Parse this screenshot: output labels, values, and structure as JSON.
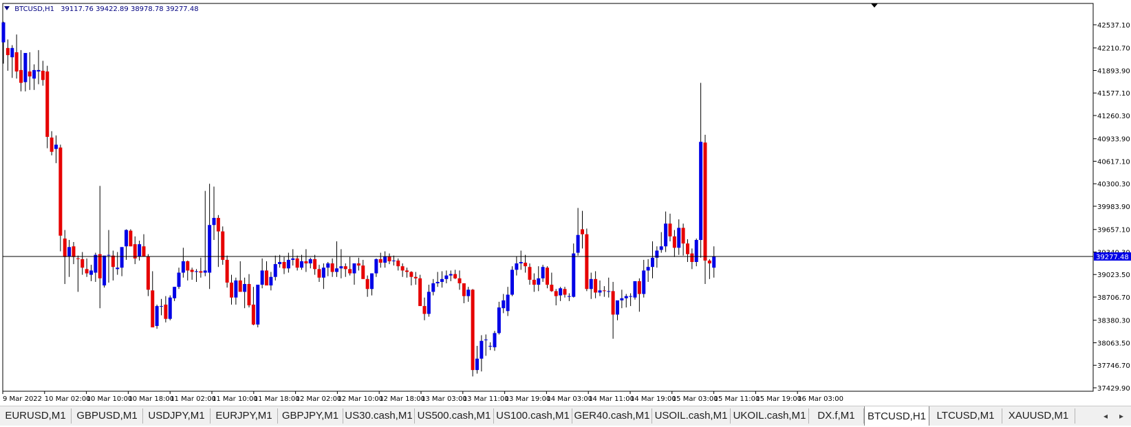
{
  "header": {
    "symbol_label": "BTCUSD,H1",
    "ohlc_label": "39117.76 39422.89 38978.78 39277.48"
  },
  "colors": {
    "bull_candle": "#0000e6",
    "bear_candle": "#e60000",
    "wick": "#000000",
    "price_line": "#000000",
    "price_label_bg": "#0000e6",
    "price_label_text": "#ffffff",
    "chart_bg": "#ffffff",
    "axis_text": "#000000"
  },
  "chart_data": {
    "type": "candlestick",
    "symbol": "BTCUSD",
    "timeframe": "H1",
    "ylim": [
      37429.9,
      42690
    ],
    "y_ticks": [
      "42537.10",
      "42210.70",
      "41893.90",
      "41577.10",
      "41260.30",
      "40933.90",
      "40617.10",
      "40300.30",
      "39983.90",
      "39657.10",
      "39340.30",
      "39023.50",
      "38706.70",
      "38380.30",
      "38063.50",
      "37746.70",
      "37429.90"
    ],
    "x_ticks": [
      "9 Mar 2022",
      "10 Mar 02:00",
      "10 Mar 10:00",
      "10 Mar 18:00",
      "11 Mar 02:00",
      "11 Mar 10:00",
      "11 Mar 18:00",
      "12 Mar 02:00",
      "12 Mar 10:00",
      "12 Mar 18:00",
      "13 Mar 03:00",
      "13 Mar 11:00",
      "13 Mar 19:00",
      "14 Mar 03:00",
      "14 Mar 11:00",
      "14 Mar 19:00",
      "15 Mar 03:00",
      "15 Mar 11:00",
      "15 Mar 19:00",
      "16 Mar 03:00"
    ],
    "current_price": "39277.48",
    "candles": [
      {
        "o": 42290,
        "h": 42580,
        "l": 41990,
        "c": 42570
      },
      {
        "o": 42210,
        "h": 42330,
        "l": 41890,
        "c": 42110
      },
      {
        "o": 42080,
        "h": 42250,
        "l": 41790,
        "c": 42210
      },
      {
        "o": 42150,
        "h": 42400,
        "l": 41780,
        "c": 41880
      },
      {
        "o": 41900,
        "h": 42180,
        "l": 41600,
        "c": 41720
      },
      {
        "o": 41730,
        "h": 42100,
        "l": 41600,
        "c": 42140
      },
      {
        "o": 41880,
        "h": 42150,
        "l": 41620,
        "c": 41810
      },
      {
        "o": 41780,
        "h": 41980,
        "l": 41620,
        "c": 41900
      },
      {
        "o": 41880,
        "h": 42180,
        "l": 41700,
        "c": 41900
      },
      {
        "o": 41890,
        "h": 42030,
        "l": 41680,
        "c": 41760
      },
      {
        "o": 41880,
        "h": 41960,
        "l": 40800,
        "c": 40960
      },
      {
        "o": 40950,
        "h": 41040,
        "l": 40700,
        "c": 40750
      },
      {
        "o": 40790,
        "h": 40980,
        "l": 40590,
        "c": 40850
      },
      {
        "o": 40810,
        "h": 40850,
        "l": 39350,
        "c": 39570
      },
      {
        "o": 39530,
        "h": 39650,
        "l": 38890,
        "c": 39270
      },
      {
        "o": 39280,
        "h": 39510,
        "l": 38990,
        "c": 39410
      },
      {
        "o": 39420,
        "h": 39480,
        "l": 39170,
        "c": 39270
      },
      {
        "o": 39250,
        "h": 39290,
        "l": 38780,
        "c": 39240
      },
      {
        "o": 39240,
        "h": 39340,
        "l": 39020,
        "c": 39120
      },
      {
        "o": 39100,
        "h": 39250,
        "l": 38990,
        "c": 39040
      },
      {
        "o": 39020,
        "h": 39160,
        "l": 38930,
        "c": 39080
      },
      {
        "o": 39050,
        "h": 39330,
        "l": 38920,
        "c": 39300
      },
      {
        "o": 39310,
        "h": 40270,
        "l": 38550,
        "c": 38970
      },
      {
        "o": 38870,
        "h": 39220,
        "l": 38840,
        "c": 39290
      },
      {
        "o": 39290,
        "h": 39650,
        "l": 38910,
        "c": 39300
      },
      {
        "o": 39290,
        "h": 39360,
        "l": 38940,
        "c": 39130
      },
      {
        "o": 39100,
        "h": 39340,
        "l": 39020,
        "c": 39120
      },
      {
        "o": 39120,
        "h": 39390,
        "l": 39000,
        "c": 39410
      },
      {
        "o": 39420,
        "h": 39660,
        "l": 39230,
        "c": 39650
      },
      {
        "o": 39640,
        "h": 39660,
        "l": 39420,
        "c": 39420
      },
      {
        "o": 39450,
        "h": 39560,
        "l": 39170,
        "c": 39250
      },
      {
        "o": 39280,
        "h": 39500,
        "l": 39220,
        "c": 39450
      },
      {
        "o": 39420,
        "h": 39590,
        "l": 39300,
        "c": 39280
      },
      {
        "o": 39280,
        "h": 39310,
        "l": 38720,
        "c": 38810
      },
      {
        "o": 38800,
        "h": 39070,
        "l": 38540,
        "c": 38280
      },
      {
        "o": 38300,
        "h": 38600,
        "l": 38260,
        "c": 38580
      },
      {
        "o": 38580,
        "h": 38680,
        "l": 38450,
        "c": 38580
      },
      {
        "o": 38600,
        "h": 38720,
        "l": 38350,
        "c": 38400
      },
      {
        "o": 38400,
        "h": 38730,
        "l": 38380,
        "c": 38700
      },
      {
        "o": 38690,
        "h": 38850,
        "l": 38650,
        "c": 38850
      },
      {
        "o": 38850,
        "h": 39120,
        "l": 38820,
        "c": 39050
      },
      {
        "o": 39050,
        "h": 39400,
        "l": 38980,
        "c": 39210
      },
      {
        "o": 39210,
        "h": 39220,
        "l": 38940,
        "c": 39080
      },
      {
        "o": 39090,
        "h": 39120,
        "l": 38950,
        "c": 39060
      },
      {
        "o": 39060,
        "h": 39100,
        "l": 38920,
        "c": 39070
      },
      {
        "o": 39070,
        "h": 39260,
        "l": 38980,
        "c": 39050
      },
      {
        "o": 39050,
        "h": 40200,
        "l": 39000,
        "c": 39080
      },
      {
        "o": 39050,
        "h": 40300,
        "l": 38820,
        "c": 39720
      },
      {
        "o": 39720,
        "h": 40260,
        "l": 39510,
        "c": 39820
      },
      {
        "o": 39820,
        "h": 39860,
        "l": 39130,
        "c": 39630
      },
      {
        "o": 39630,
        "h": 39700,
        "l": 39160,
        "c": 39230
      },
      {
        "o": 39230,
        "h": 39290,
        "l": 38840,
        "c": 38910
      },
      {
        "o": 38910,
        "h": 39020,
        "l": 38600,
        "c": 38700
      },
      {
        "o": 38700,
        "h": 38980,
        "l": 38600,
        "c": 38940
      },
      {
        "o": 38940,
        "h": 39210,
        "l": 38790,
        "c": 38780
      },
      {
        "o": 38780,
        "h": 38980,
        "l": 38550,
        "c": 38890
      },
      {
        "o": 38890,
        "h": 39030,
        "l": 38560,
        "c": 38590
      },
      {
        "o": 38600,
        "h": 38850,
        "l": 38310,
        "c": 38320
      },
      {
        "o": 38320,
        "h": 38720,
        "l": 38280,
        "c": 38880
      },
      {
        "o": 38880,
        "h": 39250,
        "l": 38830,
        "c": 39080
      },
      {
        "o": 39080,
        "h": 39210,
        "l": 38890,
        "c": 38870
      },
      {
        "o": 38870,
        "h": 39060,
        "l": 38800,
        "c": 38990
      },
      {
        "o": 38990,
        "h": 39290,
        "l": 38940,
        "c": 39170
      },
      {
        "o": 39170,
        "h": 39300,
        "l": 39120,
        "c": 39200
      },
      {
        "o": 39200,
        "h": 39270,
        "l": 39030,
        "c": 39110
      },
      {
        "o": 39110,
        "h": 39330,
        "l": 39050,
        "c": 39230
      },
      {
        "o": 39230,
        "h": 39380,
        "l": 39150,
        "c": 39250
      },
      {
        "o": 39250,
        "h": 39290,
        "l": 39080,
        "c": 39120
      },
      {
        "o": 39120,
        "h": 39300,
        "l": 39090,
        "c": 39210
      },
      {
        "o": 39210,
        "h": 39380,
        "l": 39060,
        "c": 39180
      },
      {
        "o": 39180,
        "h": 39260,
        "l": 39110,
        "c": 39240
      },
      {
        "o": 39240,
        "h": 39300,
        "l": 39020,
        "c": 39100
      },
      {
        "o": 39100,
        "h": 39160,
        "l": 38920,
        "c": 38980
      },
      {
        "o": 38980,
        "h": 39180,
        "l": 38820,
        "c": 39120
      },
      {
        "o": 39120,
        "h": 39200,
        "l": 39000,
        "c": 39180
      },
      {
        "o": 39180,
        "h": 39250,
        "l": 38990,
        "c": 39060
      },
      {
        "o": 39060,
        "h": 39490,
        "l": 38990,
        "c": 39110
      },
      {
        "o": 39110,
        "h": 39380,
        "l": 38970,
        "c": 39140
      },
      {
        "o": 39140,
        "h": 39180,
        "l": 38990,
        "c": 39100
      },
      {
        "o": 39100,
        "h": 39270,
        "l": 39010,
        "c": 39040
      },
      {
        "o": 39040,
        "h": 39150,
        "l": 38880,
        "c": 39180
      },
      {
        "o": 39180,
        "h": 39260,
        "l": 39080,
        "c": 39150
      },
      {
        "o": 39150,
        "h": 39230,
        "l": 39020,
        "c": 38960
      },
      {
        "o": 38960,
        "h": 39010,
        "l": 38710,
        "c": 38820
      },
      {
        "o": 38820,
        "h": 39040,
        "l": 38730,
        "c": 39040
      },
      {
        "o": 39040,
        "h": 39250,
        "l": 38990,
        "c": 39240
      },
      {
        "o": 39240,
        "h": 39330,
        "l": 39120,
        "c": 39190
      },
      {
        "o": 39190,
        "h": 39350,
        "l": 39120,
        "c": 39280
      },
      {
        "o": 39280,
        "h": 39320,
        "l": 39170,
        "c": 39210
      },
      {
        "o": 39210,
        "h": 39290,
        "l": 39150,
        "c": 39220
      },
      {
        "o": 39220,
        "h": 39250,
        "l": 39080,
        "c": 39140
      },
      {
        "o": 39140,
        "h": 39180,
        "l": 38990,
        "c": 39080
      },
      {
        "o": 39080,
        "h": 39120,
        "l": 38980,
        "c": 39060
      },
      {
        "o": 39060,
        "h": 39070,
        "l": 38870,
        "c": 38990
      },
      {
        "o": 38990,
        "h": 39060,
        "l": 38880,
        "c": 38970
      },
      {
        "o": 38970,
        "h": 39020,
        "l": 38600,
        "c": 38580
      },
      {
        "o": 38580,
        "h": 38700,
        "l": 38380,
        "c": 38470
      },
      {
        "o": 38470,
        "h": 38880,
        "l": 38430,
        "c": 38780
      },
      {
        "o": 38780,
        "h": 38960,
        "l": 38730,
        "c": 38900
      },
      {
        "o": 38900,
        "h": 39060,
        "l": 38850,
        "c": 38920
      },
      {
        "o": 38920,
        "h": 39070,
        "l": 38840,
        "c": 38960
      },
      {
        "o": 38960,
        "h": 39080,
        "l": 38900,
        "c": 39010
      },
      {
        "o": 39010,
        "h": 39080,
        "l": 38930,
        "c": 39030
      },
      {
        "o": 39030,
        "h": 39090,
        "l": 38960,
        "c": 38970
      },
      {
        "o": 38970,
        "h": 39080,
        "l": 38810,
        "c": 38900
      },
      {
        "o": 38900,
        "h": 38900,
        "l": 38620,
        "c": 38720
      },
      {
        "o": 38720,
        "h": 38850,
        "l": 38640,
        "c": 38810
      },
      {
        "o": 38810,
        "h": 38820,
        "l": 37590,
        "c": 37680
      },
      {
        "o": 37680,
        "h": 38020,
        "l": 37630,
        "c": 37840
      },
      {
        "o": 37840,
        "h": 38170,
        "l": 37660,
        "c": 38090
      },
      {
        "o": 38100,
        "h": 38180,
        "l": 37880,
        "c": 38110
      },
      {
        "o": 38020,
        "h": 38070,
        "l": 37960,
        "c": 38020
      },
      {
        "o": 38000,
        "h": 38230,
        "l": 37950,
        "c": 38200
      },
      {
        "o": 38200,
        "h": 38640,
        "l": 38180,
        "c": 38560
      },
      {
        "o": 38550,
        "h": 38750,
        "l": 38480,
        "c": 38660
      },
      {
        "o": 38510,
        "h": 38850,
        "l": 38440,
        "c": 38740
      },
      {
        "o": 38740,
        "h": 39140,
        "l": 38720,
        "c": 39090
      },
      {
        "o": 39090,
        "h": 39280,
        "l": 39010,
        "c": 39180
      },
      {
        "o": 39180,
        "h": 39360,
        "l": 39090,
        "c": 39200
      },
      {
        "o": 39190,
        "h": 39300,
        "l": 39050,
        "c": 39140
      },
      {
        "o": 39130,
        "h": 39180,
        "l": 38880,
        "c": 38950
      },
      {
        "o": 38950,
        "h": 39040,
        "l": 38780,
        "c": 38880
      },
      {
        "o": 38880,
        "h": 39140,
        "l": 38790,
        "c": 38970
      },
      {
        "o": 38970,
        "h": 39160,
        "l": 38920,
        "c": 39130
      },
      {
        "o": 39120,
        "h": 39140,
        "l": 38830,
        "c": 38880
      },
      {
        "o": 38880,
        "h": 39050,
        "l": 38780,
        "c": 38790
      },
      {
        "o": 38790,
        "h": 38820,
        "l": 38590,
        "c": 38720
      },
      {
        "o": 38730,
        "h": 38850,
        "l": 38650,
        "c": 38830
      },
      {
        "o": 38820,
        "h": 38850,
        "l": 38700,
        "c": 38740
      },
      {
        "o": 38710,
        "h": 38760,
        "l": 38650,
        "c": 38720
      },
      {
        "o": 38710,
        "h": 39460,
        "l": 38700,
        "c": 39320
      },
      {
        "o": 39330,
        "h": 39960,
        "l": 39290,
        "c": 39580
      },
      {
        "o": 39660,
        "h": 39920,
        "l": 39390,
        "c": 39590
      },
      {
        "o": 39590,
        "h": 39670,
        "l": 38790,
        "c": 38820
      },
      {
        "o": 38820,
        "h": 39050,
        "l": 38680,
        "c": 38960
      },
      {
        "o": 38960,
        "h": 39070,
        "l": 38690,
        "c": 38770
      },
      {
        "o": 38770,
        "h": 38940,
        "l": 38720,
        "c": 38800
      },
      {
        "o": 38800,
        "h": 38860,
        "l": 38710,
        "c": 38790
      },
      {
        "o": 38790,
        "h": 38980,
        "l": 38700,
        "c": 38790
      },
      {
        "o": 38790,
        "h": 38920,
        "l": 38120,
        "c": 38460
      },
      {
        "o": 38460,
        "h": 38620,
        "l": 38380,
        "c": 38660
      },
      {
        "o": 38660,
        "h": 38810,
        "l": 38550,
        "c": 38690
      },
      {
        "o": 38690,
        "h": 38750,
        "l": 38560,
        "c": 38720
      },
      {
        "o": 38720,
        "h": 38760,
        "l": 38580,
        "c": 38720
      },
      {
        "o": 38700,
        "h": 38890,
        "l": 38670,
        "c": 38930
      },
      {
        "o": 38930,
        "h": 38970,
        "l": 38500,
        "c": 38750
      },
      {
        "o": 38750,
        "h": 39230,
        "l": 38700,
        "c": 39080
      },
      {
        "o": 39080,
        "h": 39240,
        "l": 38920,
        "c": 39130
      },
      {
        "o": 39130,
        "h": 39490,
        "l": 38970,
        "c": 39260
      },
      {
        "o": 39260,
        "h": 39420,
        "l": 39120,
        "c": 39360
      },
      {
        "o": 39370,
        "h": 39620,
        "l": 39330,
        "c": 39420
      },
      {
        "o": 39420,
        "h": 39910,
        "l": 39340,
        "c": 39740
      },
      {
        "o": 39740,
        "h": 39880,
        "l": 39490,
        "c": 39560
      },
      {
        "o": 39560,
        "h": 39650,
        "l": 39270,
        "c": 39400
      },
      {
        "o": 39400,
        "h": 39800,
        "l": 39300,
        "c": 39680
      },
      {
        "o": 39680,
        "h": 39740,
        "l": 39290,
        "c": 39460
      },
      {
        "o": 39460,
        "h": 39520,
        "l": 39200,
        "c": 39310
      },
      {
        "o": 39320,
        "h": 39390,
        "l": 39100,
        "c": 39200
      },
      {
        "o": 39200,
        "h": 39530,
        "l": 39140,
        "c": 39510
      },
      {
        "o": 39510,
        "h": 41720,
        "l": 39260,
        "c": 40890
      },
      {
        "o": 40880,
        "h": 40990,
        "l": 38890,
        "c": 39220
      },
      {
        "o": 39220,
        "h": 39240,
        "l": 38960,
        "c": 39180
      },
      {
        "o": 39120,
        "h": 39420,
        "l": 38980,
        "c": 39280
      }
    ]
  },
  "tabs": [
    {
      "label": "EURUSD,M1"
    },
    {
      "label": "GBPUSD,M1"
    },
    {
      "label": "USDJPY,M1"
    },
    {
      "label": "EURJPY,M1"
    },
    {
      "label": "GBPJPY,M1"
    },
    {
      "label": "US30.cash,M1"
    },
    {
      "label": "US500.cash,M1"
    },
    {
      "label": "US100.cash,M1"
    },
    {
      "label": "GER40.cash,M1"
    },
    {
      "label": "USOIL.cash,M1"
    },
    {
      "label": "UKOIL.cash,M1"
    },
    {
      "label": "DX.f,M1"
    },
    {
      "label": "BTCUSD,H1",
      "active": true
    },
    {
      "label": "LTCUSD,M1"
    },
    {
      "label": "XAUUSD,M1"
    }
  ],
  "tab_scroll": {
    "left_glyph": "◂",
    "right_glyph": "▸"
  }
}
